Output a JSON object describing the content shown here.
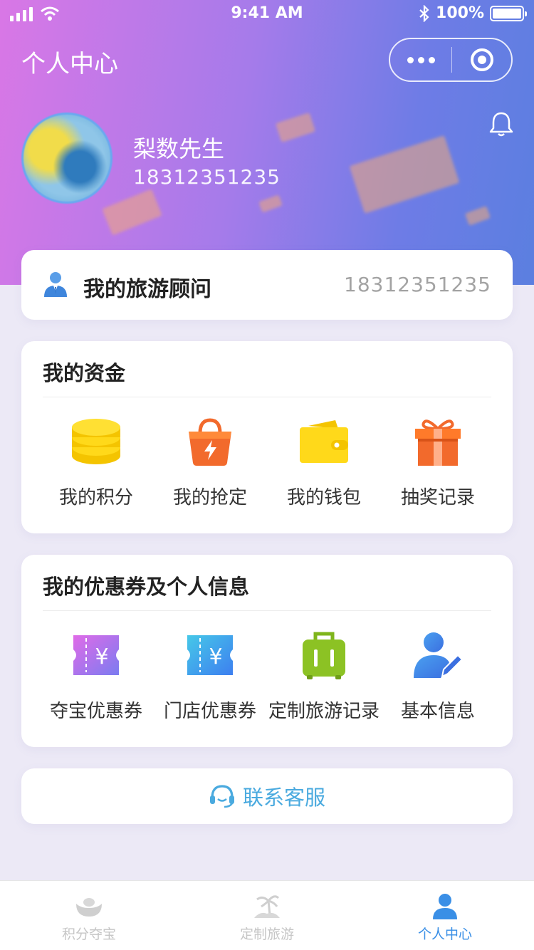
{
  "status_bar": {
    "time": "9:41 AM",
    "battery": "100%"
  },
  "nav": {
    "title": "个人中心"
  },
  "user": {
    "name": "梨数先生",
    "phone": "18312351235"
  },
  "advisor": {
    "label": "我的旅游顾问",
    "phone": "18312351235"
  },
  "funds": {
    "title": "我的资金",
    "items": [
      {
        "label": "我的积分",
        "icon": "coins-stack-icon"
      },
      {
        "label": "我的抢定",
        "icon": "shopping-bag-bolt-icon"
      },
      {
        "label": "我的钱包",
        "icon": "wallet-icon"
      },
      {
        "label": "抽奖记录",
        "icon": "gift-icon"
      }
    ]
  },
  "coupons": {
    "title": "我的优惠券及个人信息",
    "items": [
      {
        "label": "夺宝优惠券",
        "icon": "ticket-yen-purple-icon"
      },
      {
        "label": "门店优惠券",
        "icon": "ticket-yen-blue-icon"
      },
      {
        "label": "定制旅游记录",
        "icon": "luggage-icon"
      },
      {
        "label": "基本信息",
        "icon": "user-edit-icon"
      }
    ]
  },
  "service": {
    "label": "联系客服"
  },
  "tabbar": {
    "items": [
      {
        "label": "积分夺宝",
        "active": false
      },
      {
        "label": "定制旅游",
        "active": false
      },
      {
        "label": "个人中心",
        "active": true
      }
    ]
  },
  "colors": {
    "accent": "#3a8fe6",
    "service": "#4aaadf",
    "gradient_start": "#d977e6",
    "gradient_end": "#5b7fe0"
  }
}
